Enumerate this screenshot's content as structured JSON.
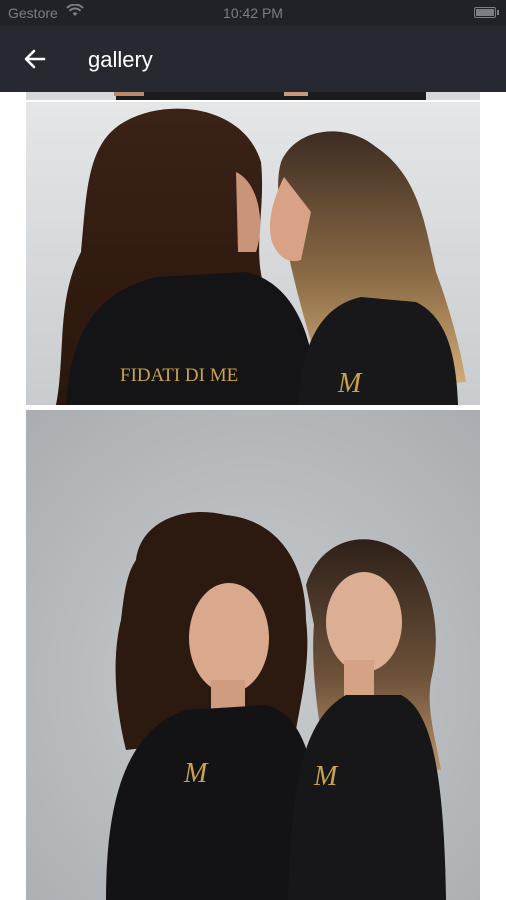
{
  "status_bar": {
    "carrier": "Gestore",
    "time": "10:42 PM"
  },
  "app_bar": {
    "title": "gallery",
    "back_icon": "arrow-left-icon"
  },
  "gallery": {
    "photos": [
      {
        "brand_text": "FIDATI DI ME",
        "logo_monogram": "M"
      },
      {
        "logo_monogram": "M"
      }
    ]
  },
  "colors": {
    "status_bar_bg": "#1f2328",
    "app_bar_bg": "#262a30",
    "logo_gold": "#c9a24a"
  }
}
